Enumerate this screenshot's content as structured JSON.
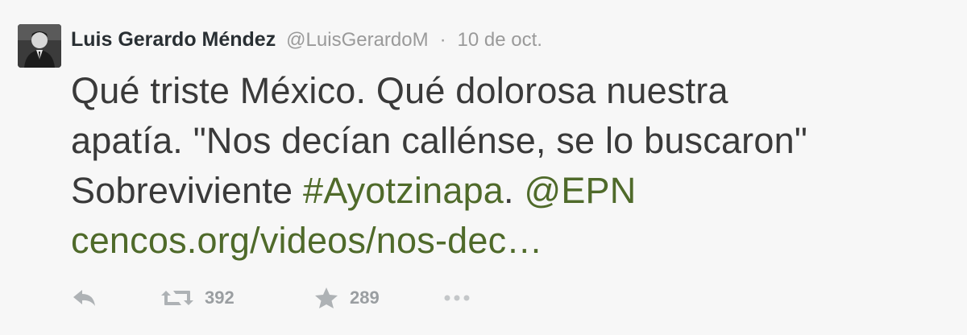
{
  "tweet": {
    "author": {
      "display_name": "Luis Gerardo Méndez",
      "handle": "@LuisGerardoM"
    },
    "separator": "·",
    "date": "10 de oct.",
    "text": {
      "line1": "Qué triste México. Qué dolorosa nuestra",
      "line2": "apatía. \"Nos decían callénse, se lo buscaron\"",
      "line3_text": "Sobreviviente ",
      "hashtag": "#Ayotzinapa",
      "line3_period": ". ",
      "mention": "@EPN",
      "url": "cencos.org/videos/nos-dec…"
    },
    "actions": {
      "reply_icon": "reply-icon",
      "retweet_icon": "retweet-icon",
      "retweet_count": "392",
      "favorite_icon": "star-icon",
      "favorite_count": "289",
      "more_icon": "more-icon"
    },
    "colors": {
      "background": "#f7f7f7",
      "link": "#4f6a2a",
      "muted": "#9a9a9a"
    }
  }
}
